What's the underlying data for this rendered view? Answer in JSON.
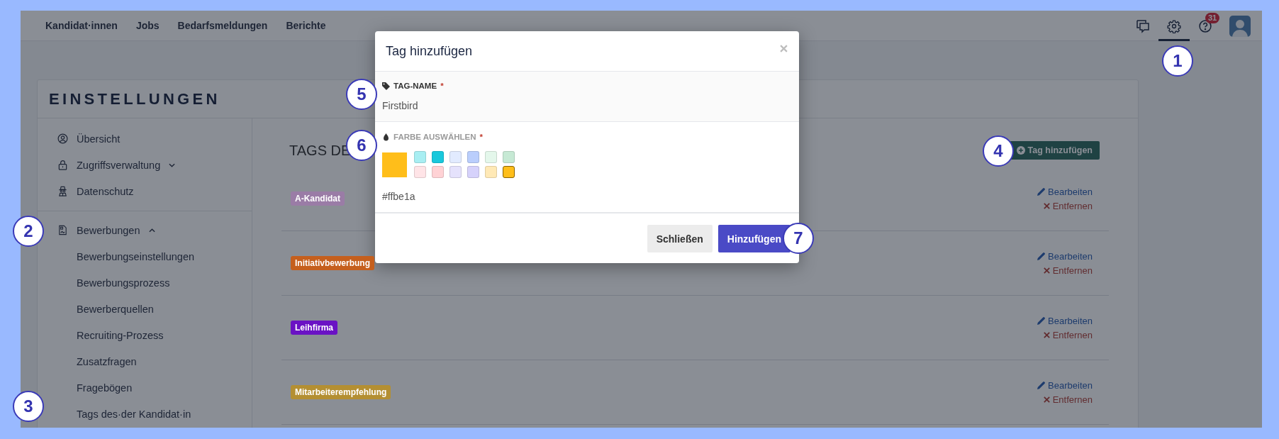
{
  "nav": {
    "items": [
      {
        "label": "Kandidat·innen"
      },
      {
        "label": "Jobs"
      },
      {
        "label": "Bedarfsmeldungen"
      },
      {
        "label": "Berichte"
      }
    ],
    "icons": [
      {
        "kind": "chat",
        "selected": false
      },
      {
        "kind": "settings",
        "selected": true
      },
      {
        "kind": "help",
        "selected": false,
        "badge": "31"
      },
      {
        "kind": "avatar",
        "selected": false
      }
    ]
  },
  "settings": {
    "title": "EINSTELLUNGEN"
  },
  "sidebar": {
    "sections": [
      {
        "items": [
          {
            "label": "Übersicht",
            "kind": "profile"
          },
          {
            "label": "Zugriffsverwaltung",
            "kind": "lock",
            "expanded": false
          },
          {
            "label": "Datenschutz",
            "kind": "spy"
          }
        ]
      },
      {
        "items": [
          {
            "label": "Bewerbungen",
            "kind": "document",
            "expanded": true,
            "children": [
              {
                "label": "Bewerbungseinstellungen"
              },
              {
                "label": "Bewerbungsprozess"
              },
              {
                "label": "Bewerberquellen"
              },
              {
                "label": "Recruiting-Prozess"
              },
              {
                "label": "Zusatzfragen"
              },
              {
                "label": "Fragebögen"
              },
              {
                "label": "Tags des·der Kandidat·in"
              }
            ]
          }
        ]
      }
    ]
  },
  "content": {
    "title": "TAGS DE",
    "add_button": "Tag hinzufügen",
    "tags": [
      {
        "label": "A-Kandidat",
        "color": "#9a7ca6",
        "edit": "Bearbeiten",
        "remove": "Entfernen"
      },
      {
        "label": "Initiativbewerbung",
        "color": "#c55f1d",
        "edit": "Bearbeiten",
        "remove": "Entfernen"
      },
      {
        "label": "Leihfirma",
        "color": "#6a12c4",
        "edit": "Bearbeiten",
        "remove": "Entfernen"
      },
      {
        "label": "Mitarbeiterempfehlung",
        "color": "#b48f32",
        "edit": "Bearbeiten",
        "remove": "Entfernen"
      }
    ]
  },
  "dialog": {
    "title": "Tag hinzufügen",
    "tag_name": {
      "label": "TAG-NAME",
      "required_mark": "*",
      "value": "Firstbird"
    },
    "color": {
      "label": "FARBE AUSWÄHLEN",
      "required_mark": "*",
      "value": "#ffbe1a",
      "swatches": [
        {
          "color": "#a8eef2",
          "selected": false
        },
        {
          "color": "#19c8dc",
          "selected": false
        },
        {
          "color": "#e2ebff",
          "selected": false
        },
        {
          "color": "#bacefc",
          "selected": false
        },
        {
          "color": "#e4f7eb",
          "selected": false
        },
        {
          "color": "#c6e9d4",
          "selected": false
        },
        {
          "color": "#ffe4e7",
          "selected": false
        },
        {
          "color": "#ffd2d5",
          "selected": false
        },
        {
          "color": "#e5e2fc",
          "selected": false
        },
        {
          "color": "#d6d2fb",
          "selected": false
        },
        {
          "color": "#ffe9b6",
          "selected": false
        },
        {
          "color": "#ffbe1a",
          "selected": true
        }
      ]
    },
    "buttons": [
      {
        "label": "Schließen",
        "kind": "secondary"
      },
      {
        "label": "Hinzufügen",
        "kind": "primary"
      }
    ]
  },
  "callouts": [
    {
      "number": "1"
    },
    {
      "number": "2"
    },
    {
      "number": "3"
    },
    {
      "number": "4"
    },
    {
      "number": "5"
    },
    {
      "number": "6"
    },
    {
      "number": "7"
    }
  ]
}
